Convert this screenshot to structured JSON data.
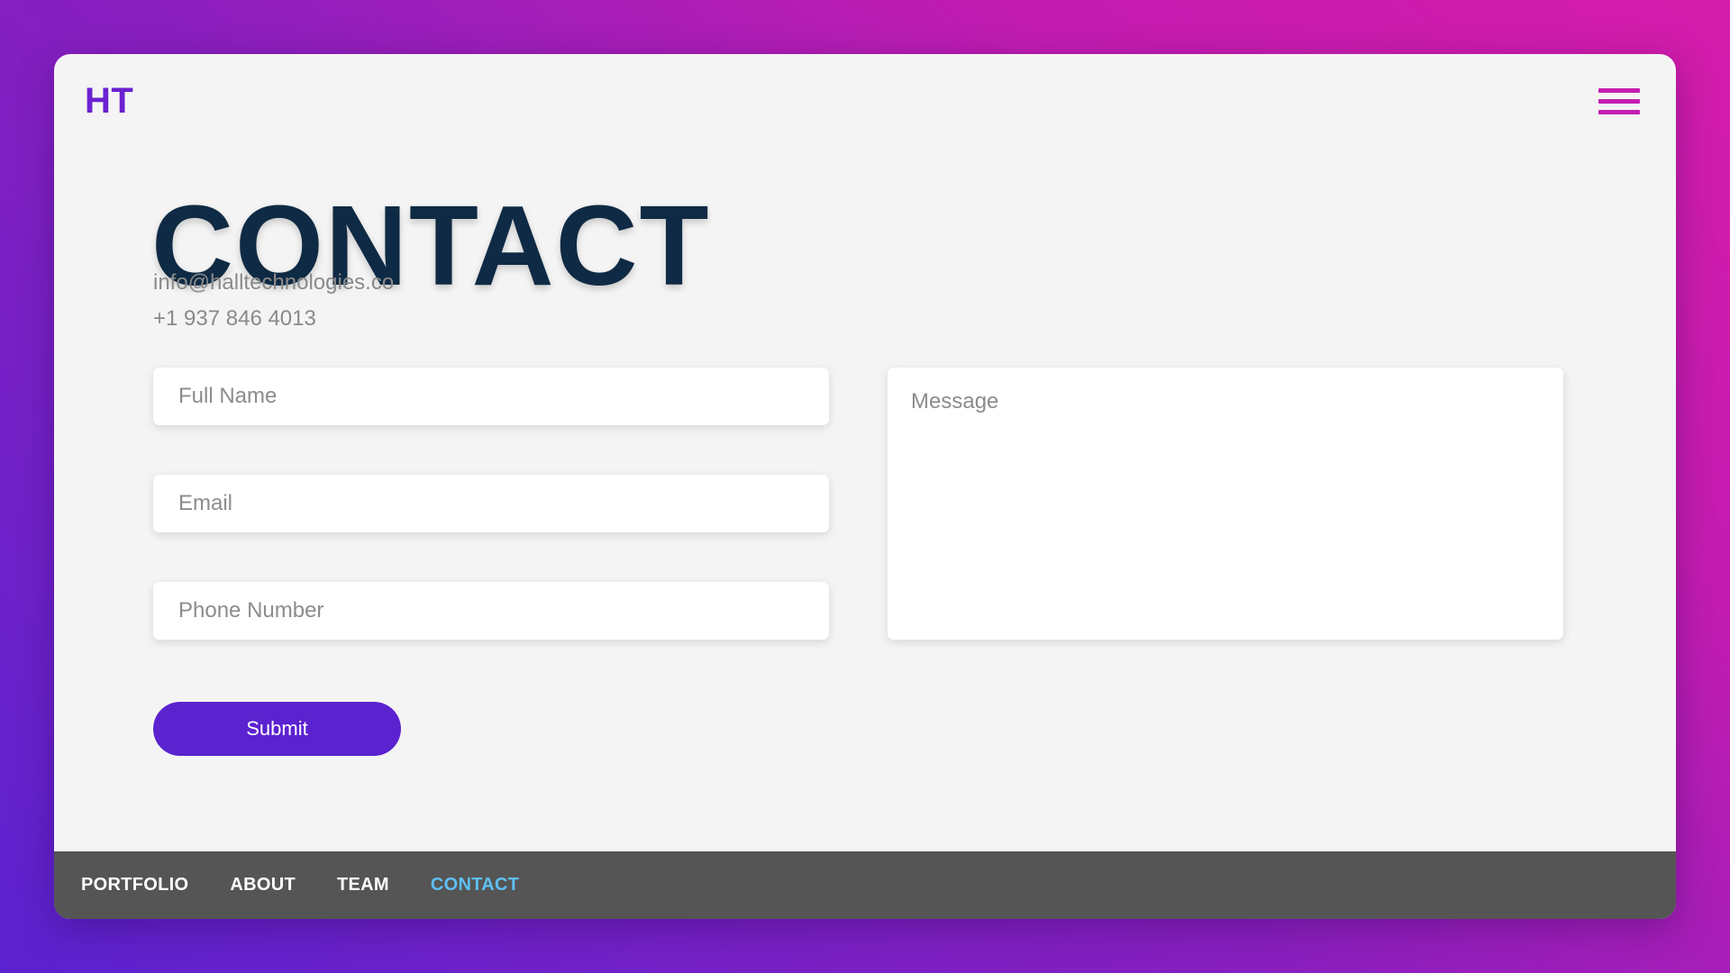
{
  "header": {
    "logo": "HT",
    "menu_icon": "hamburger-menu-icon"
  },
  "page": {
    "title": "CONTACT",
    "email": "info@halltechnologies.co",
    "phone": "+1 937 846 4013"
  },
  "form": {
    "full_name_placeholder": "Full Name",
    "email_placeholder": "Email",
    "phone_placeholder": "Phone Number",
    "message_placeholder": "Message",
    "submit_label": "Submit"
  },
  "footer_nav": {
    "items": [
      {
        "label": "PORTFOLIO",
        "active": false
      },
      {
        "label": "ABOUT",
        "active": false
      },
      {
        "label": "TEAM",
        "active": false
      },
      {
        "label": "CONTACT",
        "active": true
      }
    ]
  },
  "colors": {
    "background_gradient_start": "#5b22cf",
    "background_gradient_end": "#d51cab",
    "logo": "#6a22d0",
    "title": "#0f2a44",
    "accent_button": "#5b22cf",
    "menu_icon": "#c41fb0",
    "footer_bg": "#555555",
    "active_nav": "#5ec0f2"
  }
}
